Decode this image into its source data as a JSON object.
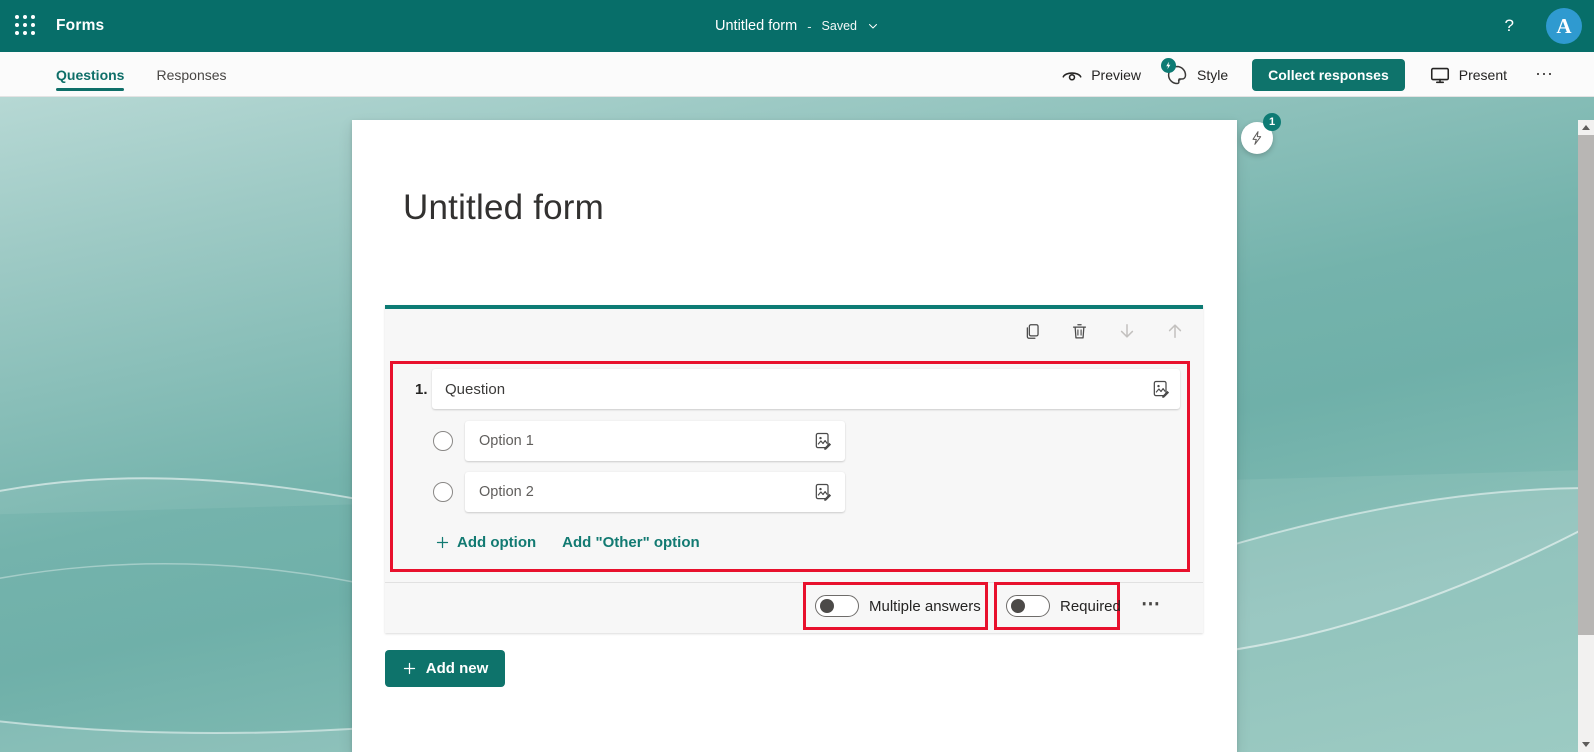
{
  "colors": {
    "header_teal": "#076e69",
    "accent_teal": "#0e736b",
    "annotation_red": "#e8112d",
    "avatar_blue": "#2f9ad0",
    "background_teal": "#74b3ac"
  },
  "header": {
    "app_name": "Forms",
    "doc_title": "Untitled form",
    "dash": "-",
    "saved_status": "Saved",
    "help": "?",
    "avatar_initial": "A"
  },
  "tabs": {
    "questions": "Questions",
    "responses": "Responses"
  },
  "actions": {
    "preview": "Preview",
    "style": "Style",
    "collect": "Collect responses",
    "present": "Present",
    "more": "⋯"
  },
  "form": {
    "title": "Untitled form"
  },
  "question": {
    "number": "1.",
    "title_placeholder": "Question",
    "options": [
      {
        "label": "Option 1"
      },
      {
        "label": "Option 2"
      }
    ],
    "add_option": "Add option",
    "add_other": "Add \"Other\" option",
    "toggles": {
      "multiple": "Multiple answers",
      "required": "Required"
    },
    "more": "⋯"
  },
  "footer": {
    "add_new": "Add new"
  },
  "assistant": {
    "badge_count": "1"
  }
}
